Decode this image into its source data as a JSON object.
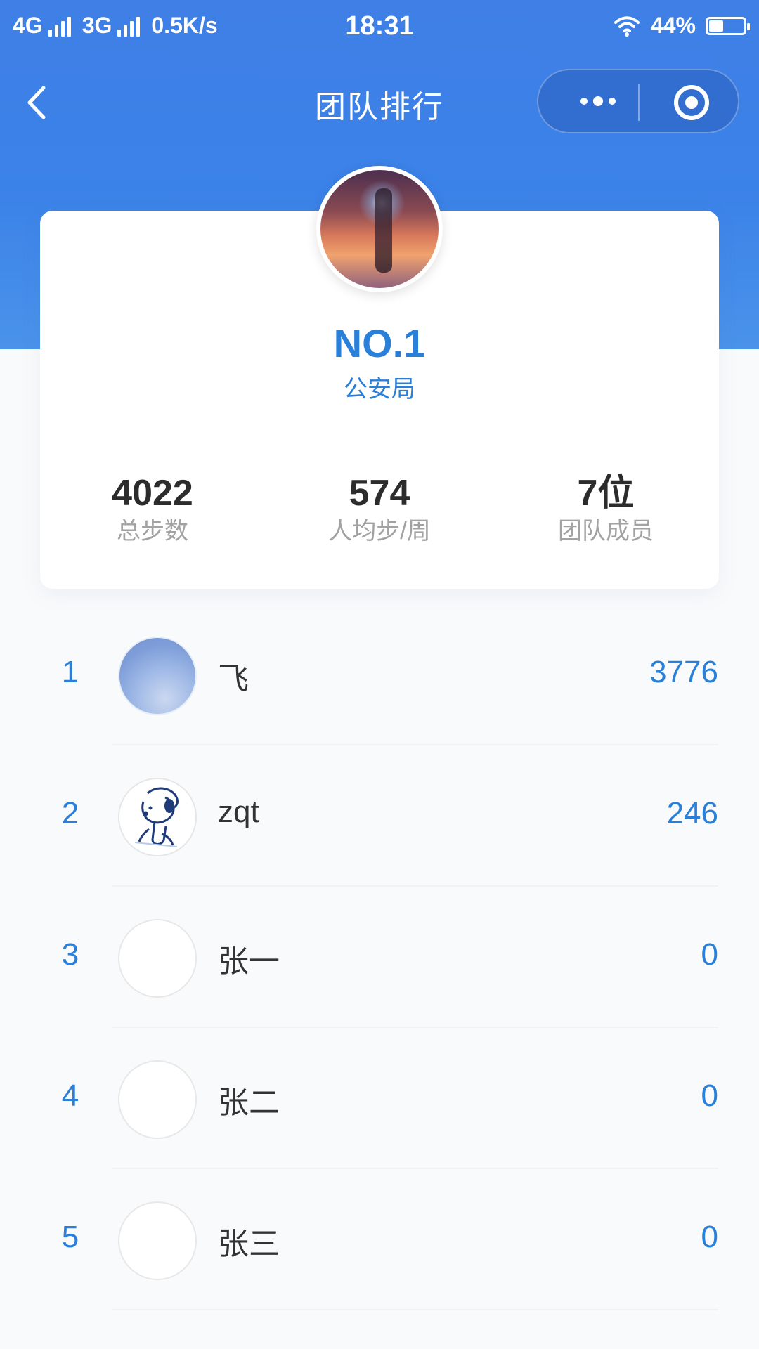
{
  "status_bar": {
    "network_1": "4G",
    "network_2": "3G",
    "speed": "0.5K/s",
    "time": "18:31",
    "battery_percent": "44%"
  },
  "nav": {
    "title": "团队排行",
    "back_icon": "chevron-left-icon",
    "more_icon": "more-icon",
    "close_icon": "target-icon"
  },
  "top_team": {
    "rank": "NO.1",
    "name": "公安局",
    "stats": [
      {
        "value": "4022",
        "label": "总步数"
      },
      {
        "value": "574",
        "label": "人均步/周"
      },
      {
        "value": "7位",
        "label": "团队成员"
      }
    ]
  },
  "ranking": [
    {
      "rank": "1",
      "name": "飞",
      "score": "3776",
      "avatar": "sky"
    },
    {
      "rank": "2",
      "name": "zqt",
      "score": "246",
      "avatar": "snoopy"
    },
    {
      "rank": "3",
      "name": "张一",
      "score": "0",
      "avatar": "empty"
    },
    {
      "rank": "4",
      "name": "张二",
      "score": "0",
      "avatar": "empty"
    },
    {
      "rank": "5",
      "name": "张三",
      "score": "0",
      "avatar": "empty"
    }
  ],
  "colors": {
    "header": "#3f7fe6",
    "accent": "#2a7fd9",
    "text_primary": "#333333",
    "text_secondary": "#a2a2a2"
  }
}
